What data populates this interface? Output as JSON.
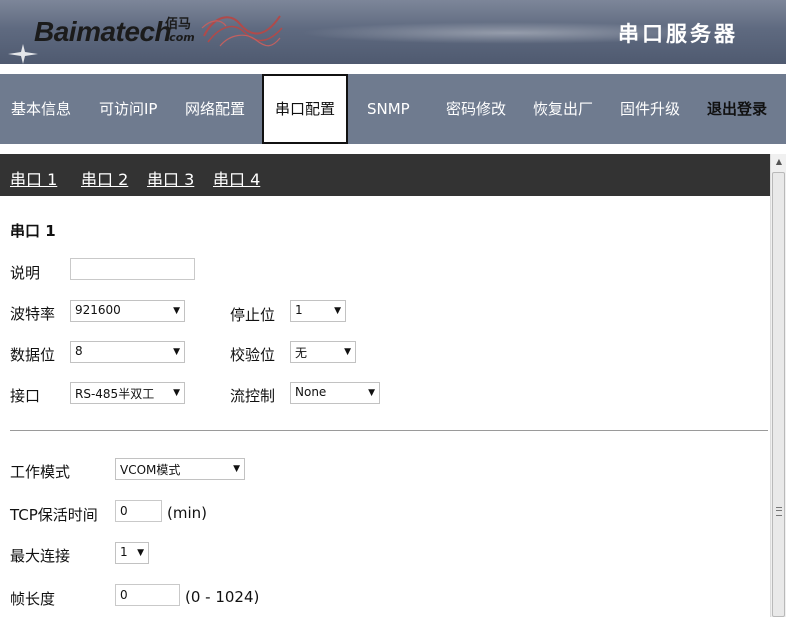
{
  "header": {
    "logo_text": "Baimatech",
    "logo_cn": "佰马",
    "logo_domain": ".com",
    "product_title": "串口服务器"
  },
  "nav": {
    "items": [
      {
        "label": "基本信息"
      },
      {
        "label": "可访问IP"
      },
      {
        "label": "网络配置"
      },
      {
        "label": "串口配置",
        "active": true
      },
      {
        "label": "SNMP"
      },
      {
        "label": "密码修改"
      },
      {
        "label": "恢复出厂"
      },
      {
        "label": "固件升级"
      },
      {
        "label": "退出登录"
      }
    ]
  },
  "subtabs": [
    "串口 1",
    "串口 2",
    "串口 3",
    "串口 4"
  ],
  "form": {
    "section_title": "串口 1",
    "description": {
      "label": "说明",
      "value": ""
    },
    "baud_rate": {
      "label": "波特率",
      "value": "921600"
    },
    "stop_bits": {
      "label": "停止位",
      "value": "1"
    },
    "data_bits": {
      "label": "数据位",
      "value": "8"
    },
    "parity": {
      "label": "校验位",
      "value": "无"
    },
    "interface": {
      "label": "接口",
      "value": "RS-485半双工"
    },
    "flow_control": {
      "label": "流控制",
      "value": "None"
    },
    "work_mode": {
      "label": "工作模式",
      "value": "VCOM模式"
    },
    "tcp_keepalive": {
      "label": "TCP保活时间",
      "value": "0",
      "unit": "(min)"
    },
    "max_connections": {
      "label": "最大连接",
      "value": "1"
    },
    "frame_length": {
      "label": "帧长度",
      "value": "0",
      "unit": "(0 - 1024)"
    }
  },
  "colors": {
    "banner": "#5f6a80",
    "nav": "#6f7b8f",
    "subtab_bar": "#333333"
  }
}
